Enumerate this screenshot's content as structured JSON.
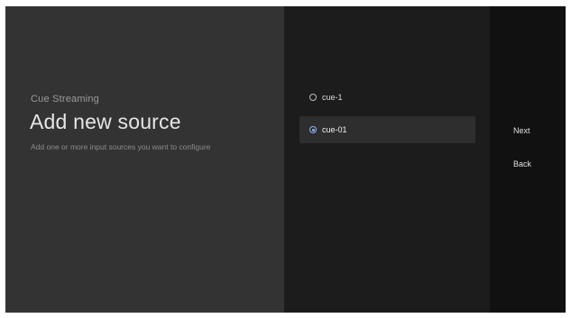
{
  "guidance": {
    "breadcrumb": "Cue Streaming",
    "title": "Add new source",
    "description": "Add one or more input sources you want to configure"
  },
  "actions": {
    "options": [
      {
        "label": "cue-1",
        "selected": false
      },
      {
        "label": "cue-01",
        "selected": true
      }
    ]
  },
  "buttons": {
    "next_label": "Next",
    "back_label": "Back"
  },
  "colors": {
    "guidance_bg": "#333333",
    "actions_bg": "#1c1c1c",
    "buttons_bg": "#111111",
    "accent": "#8ab4f8"
  },
  "icons": {
    "radio_unchecked": "radio-unchecked-icon",
    "radio_checked": "radio-checked-icon"
  }
}
